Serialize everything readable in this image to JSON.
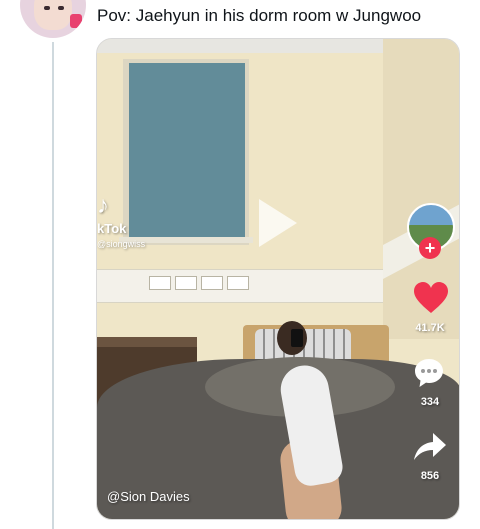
{
  "tweet": {
    "text": "Pov: Jaehyun in his dorm room w Jungwoo"
  },
  "video": {
    "tiktok_logo_glyph": "♪",
    "tiktok_wordmark": "kTok",
    "tiktok_handle": "@siongwiss",
    "author_label": "@Sion Davies",
    "likes": "41.7K",
    "comments": "334",
    "shares": "856",
    "follow_symbol": "+",
    "like_color": "#f0334f",
    "follow_color": "#f0334f"
  },
  "icons": {
    "play": "play-icon",
    "heart": "heart-icon",
    "comment": "comment-icon",
    "share": "share-icon",
    "tiktok": "tiktok-logo-icon"
  }
}
